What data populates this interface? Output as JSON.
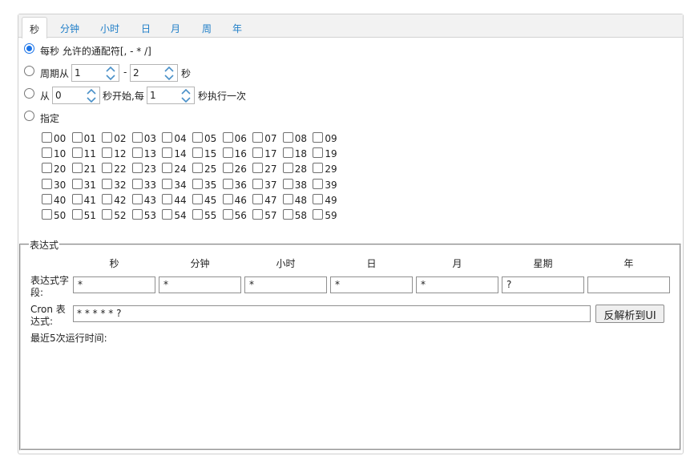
{
  "tabs": [
    {
      "label": "秒",
      "active": true
    },
    {
      "label": "分钟"
    },
    {
      "label": "小时"
    },
    {
      "label": "日"
    },
    {
      "label": "月"
    },
    {
      "label": "周"
    },
    {
      "label": "年"
    }
  ],
  "options": {
    "every": {
      "label": "每秒 允许的通配符[, - * /]",
      "checked": true
    },
    "cycle": {
      "prefix": "周期从",
      "from": "1",
      "sep": "-",
      "to": "2",
      "suffix": "秒"
    },
    "from": {
      "prefix": "从",
      "start": "0",
      "middle": "秒开始,每",
      "step": "1",
      "suffix": "秒执行一次"
    },
    "specify": {
      "label": "指定"
    }
  },
  "checkbox_values": [
    "00",
    "01",
    "02",
    "03",
    "04",
    "05",
    "06",
    "07",
    "08",
    "09",
    "10",
    "11",
    "12",
    "13",
    "14",
    "15",
    "16",
    "17",
    "18",
    "19",
    "20",
    "21",
    "22",
    "23",
    "24",
    "25",
    "26",
    "27",
    "28",
    "29",
    "30",
    "31",
    "32",
    "33",
    "34",
    "35",
    "36",
    "37",
    "38",
    "39",
    "40",
    "41",
    "42",
    "43",
    "44",
    "45",
    "46",
    "47",
    "48",
    "49",
    "50",
    "51",
    "52",
    "53",
    "54",
    "55",
    "56",
    "57",
    "58",
    "59"
  ],
  "expression": {
    "legend": "表达式",
    "columns": [
      "秒",
      "分钟",
      "小时",
      "日",
      "月",
      "星期",
      "年"
    ],
    "field_label_1": "表达式字",
    "field_label_2": "段:",
    "fields": [
      "*",
      "*",
      "*",
      "*",
      "*",
      "?",
      ""
    ],
    "cron_label_1": "Cron 表",
    "cron_label_2": "达式:",
    "cron_value": "* * * * * ?",
    "parse_button": "反解析到UI",
    "recent_label": "最近5次运行时间:"
  },
  "colors": {
    "accent": "#1a73e8",
    "tab_text": "#1f7ec8"
  }
}
